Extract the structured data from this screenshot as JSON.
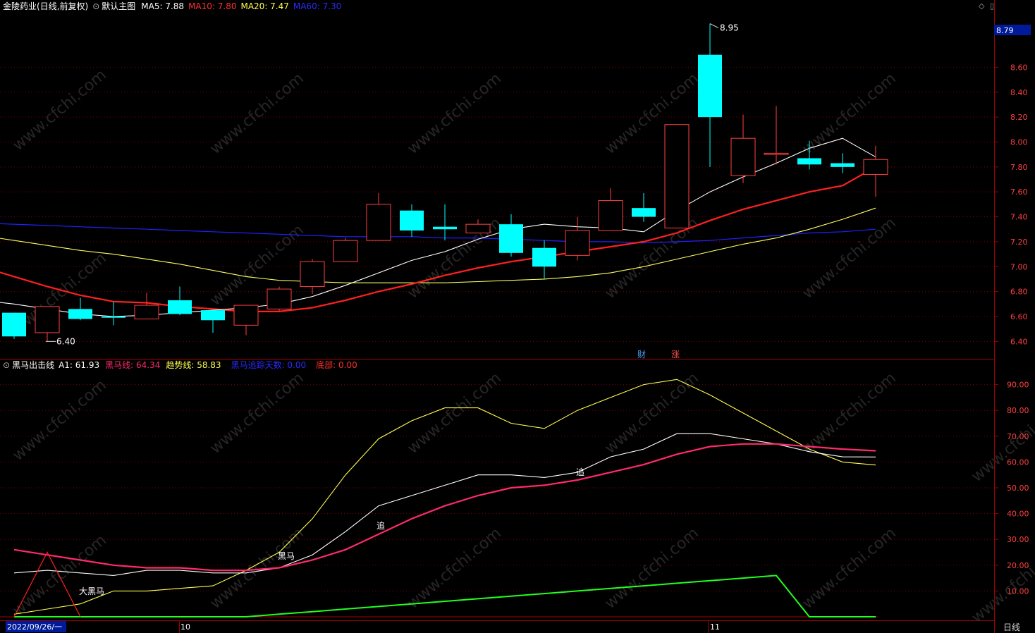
{
  "main_header": {
    "stock_name": "金陵药业",
    "mode": "(日线,前复权)",
    "view": "默认主图",
    "ma5": "MA5: 7.88",
    "ma10": "MA10: 7.80",
    "ma20": "MA20: 7.47",
    "ma60": "MA60: 7.30"
  },
  "indicator_header": {
    "name": "黑马出击线",
    "a1": "A1: 61.93",
    "heima": "黑马线: 64.34",
    "trend": "趋势线: 58.83",
    "days": "黑马追踪天数: 0.00",
    "bottom": "底部: 0.00"
  },
  "price_axis": {
    "current": "8.79",
    "ticks": [
      "8.60",
      "8.40",
      "8.20",
      "8.00",
      "7.80",
      "7.60",
      "7.40",
      "7.20",
      "7.00",
      "6.80",
      "6.60",
      "6.40"
    ],
    "tick_values": [
      8.6,
      8.4,
      8.2,
      8.0,
      7.8,
      7.6,
      7.4,
      7.2,
      7.0,
      6.8,
      6.6,
      6.4
    ]
  },
  "ind_axis": {
    "ticks": [
      "90.00",
      "80.00",
      "70.00",
      "60.00",
      "50.00",
      "40.00",
      "30.00",
      "20.00",
      "10.00"
    ],
    "tick_values": [
      90,
      80,
      70,
      60,
      50,
      40,
      30,
      20,
      10
    ]
  },
  "date_labels": {
    "start": "2022/09/26/一",
    "oct": "10",
    "nov": "11"
  },
  "timeframe": "日线",
  "annotations": {
    "high": "8.95",
    "low": "6.40",
    "cai": "财",
    "zhang": "涨",
    "zhui1": "追",
    "zhui2": "追",
    "heima": "黑马",
    "daheima": "大黑马"
  },
  "watermark": "www.cfchi.com",
  "colors": {
    "up": "#ff4040",
    "down": "#00ffff",
    "ma5": "#ffffff",
    "ma10": "#ff2020",
    "ma20": "#ffff60",
    "ma60": "#2020ff",
    "heima_line": "#ff2a6d",
    "trend_line": "#ffff50",
    "a1_line": "#ffffff",
    "green_line": "#20ff20",
    "grid": "#7a0000"
  },
  "chart_data": {
    "type": "candlestick",
    "candles": [
      {
        "o": 6.63,
        "c": 6.44,
        "h": 6.63,
        "l": 6.42
      },
      {
        "o": 6.47,
        "c": 6.68,
        "h": 6.68,
        "l": 6.4
      },
      {
        "o": 6.66,
        "c": 6.58,
        "h": 6.75,
        "l": 6.57
      },
      {
        "o": 6.6,
        "c": 6.59,
        "h": 6.72,
        "l": 6.53
      },
      {
        "o": 6.58,
        "c": 6.69,
        "h": 6.79,
        "l": 6.58
      },
      {
        "o": 6.73,
        "c": 6.62,
        "h": 6.84,
        "l": 6.61
      },
      {
        "o": 6.65,
        "c": 6.57,
        "h": 6.65,
        "l": 6.47
      },
      {
        "o": 6.53,
        "c": 6.69,
        "h": 6.69,
        "l": 6.45
      },
      {
        "o": 6.66,
        "c": 6.82,
        "h": 6.84,
        "l": 6.64
      },
      {
        "o": 6.84,
        "c": 7.04,
        "h": 7.06,
        "l": 6.78
      },
      {
        "o": 7.04,
        "c": 7.21,
        "h": 7.23,
        "l": 7.04
      },
      {
        "o": 7.21,
        "c": 7.5,
        "h": 7.59,
        "l": 7.21
      },
      {
        "o": 7.45,
        "c": 7.29,
        "h": 7.5,
        "l": 7.24
      },
      {
        "o": 7.32,
        "c": 7.3,
        "h": 7.5,
        "l": 7.21
      },
      {
        "o": 7.27,
        "c": 7.34,
        "h": 7.38,
        "l": 7.27
      },
      {
        "o": 7.34,
        "c": 7.11,
        "h": 7.42,
        "l": 7.08
      },
      {
        "o": 7.15,
        "c": 7.0,
        "h": 7.21,
        "l": 6.9
      },
      {
        "o": 7.09,
        "c": 7.29,
        "h": 7.4,
        "l": 7.05
      },
      {
        "o": 7.29,
        "c": 7.53,
        "h": 7.63,
        "l": 7.29
      },
      {
        "o": 7.47,
        "c": 7.4,
        "h": 7.59,
        "l": 7.36
      },
      {
        "o": 7.31,
        "c": 8.14,
        "h": 8.14,
        "l": 7.31
      },
      {
        "o": 8.7,
        "c": 8.2,
        "h": 8.95,
        "l": 7.8
      },
      {
        "o": 7.73,
        "c": 8.03,
        "h": 8.22,
        "l": 7.67
      },
      {
        "o": 7.9,
        "c": 7.91,
        "h": 8.29,
        "l": 7.82
      },
      {
        "o": 7.87,
        "c": 7.82,
        "h": 8.01,
        "l": 7.78
      },
      {
        "o": 7.83,
        "c": 7.8,
        "h": 7.91,
        "l": 7.75
      },
      {
        "o": 7.74,
        "c": 7.86,
        "h": 7.97,
        "l": 7.56
      }
    ],
    "ma5": [
      6.73,
      6.7,
      6.66,
      6.62,
      6.6,
      6.61,
      6.63,
      6.65,
      6.67,
      6.7,
      6.76,
      6.85,
      6.95,
      7.05,
      7.12,
      7.22,
      7.3,
      7.34,
      7.32,
      7.31,
      7.28,
      7.45,
      7.6,
      7.72,
      7.83,
      7.95,
      8.03,
      7.88
    ],
    "ma10": [
      7.0,
      6.92,
      6.84,
      6.77,
      6.72,
      6.71,
      6.68,
      6.66,
      6.64,
      6.64,
      6.67,
      6.73,
      6.8,
      6.86,
      6.93,
      6.99,
      7.04,
      7.08,
      7.12,
      7.16,
      7.2,
      7.27,
      7.37,
      7.46,
      7.53,
      7.6,
      7.65,
      7.8
    ],
    "ma20": [
      7.25,
      7.21,
      7.17,
      7.13,
      7.1,
      7.06,
      7.02,
      6.97,
      6.92,
      6.89,
      6.88,
      6.87,
      6.87,
      6.87,
      6.87,
      6.88,
      6.89,
      6.9,
      6.92,
      6.95,
      7.0,
      7.06,
      7.12,
      7.18,
      7.23,
      7.3,
      7.38,
      7.47
    ],
    "ma60": [
      7.35,
      7.34,
      7.33,
      7.32,
      7.31,
      7.3,
      7.29,
      7.28,
      7.27,
      7.26,
      7.25,
      7.24,
      7.24,
      7.24,
      7.23,
      7.23,
      7.22,
      7.21,
      7.2,
      7.2,
      7.19,
      7.2,
      7.21,
      7.23,
      7.25,
      7.27,
      7.28,
      7.3
    ],
    "heima_line": [
      26,
      24,
      22,
      20,
      19,
      19,
      18,
      18,
      19,
      22,
      26,
      32,
      38,
      43,
      47,
      50,
      51,
      53,
      56,
      59,
      63,
      66,
      67,
      67,
      66,
      65,
      64.34
    ],
    "trend_line": [
      1,
      3,
      5,
      10,
      10,
      11,
      12,
      18,
      25,
      38,
      55,
      69,
      76,
      81,
      81,
      75,
      73,
      80,
      85,
      90,
      92,
      86,
      79,
      72,
      65,
      60,
      58.83
    ],
    "a1_line": [
      17,
      18,
      17,
      16,
      18,
      18,
      17,
      17,
      19,
      24,
      33,
      43,
      47,
      51,
      55,
      55,
      54,
      56,
      62,
      65,
      71,
      71,
      69,
      67,
      64,
      62,
      61.93
    ],
    "green_line": [
      0,
      0,
      0,
      0,
      0,
      0,
      0,
      0,
      1,
      2,
      3,
      4,
      5,
      6,
      7,
      8,
      9,
      10,
      11,
      12,
      13,
      14,
      15,
      16,
      0,
      0,
      0
    ],
    "heima_spike": [
      0,
      25,
      0
    ],
    "price_range": [
      6.3,
      8.97
    ],
    "ind_range": [
      0,
      97
    ]
  }
}
